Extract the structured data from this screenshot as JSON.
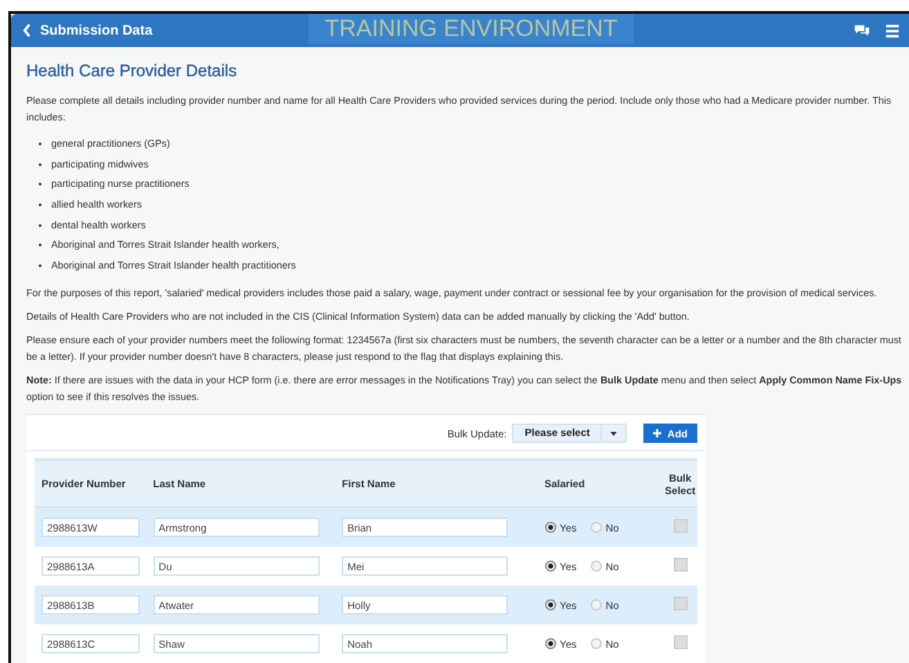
{
  "header": {
    "back_label": "Submission Data",
    "banner": "TRAINING ENVIRONMENT"
  },
  "heading": "Health Care Provider Details",
  "intro": "Please complete all details including provider number and name for all Health Care Providers who provided services during the period. Include only those who had a Medicare provider number. This includes:",
  "bullets": [
    "general practitioners (GPs)",
    "participating midwives",
    "participating nurse practitioners",
    "allied health workers",
    "dental health workers",
    "Aboriginal and Torres Strait Islander health workers,",
    "Aboriginal and Torres Strait Islander health practitioners"
  ],
  "paragraphs": [
    "For the purposes of this report, 'salaried' medical providers includes those paid a salary, wage, payment under contract or sessional fee by your organisation for the provision of medical services.",
    "Details of Health Care Providers who are not included in the CIS (Clinical Information System) data can be added manually by clicking the 'Add' button.",
    "Please ensure each of your provider numbers meet the following format: 1234567a (first six characters must be numbers, the seventh character can be a letter or a number and the 8th character must be a letter). If your provider number doesn't have 8 characters, please just respond to the flag that displays explaining this.",
    "**Note:** If there are issues with the data in your HCP form (i.e. there are error messages in the Notifications Tray) you can select the **Bulk Update** menu and then select **Apply Common Name Fix-Ups** option to see if this resolves the issues."
  ],
  "bulk_update": {
    "label": "Bulk Update:",
    "placeholder": "Please select"
  },
  "add_button": "Add",
  "table": {
    "columns": [
      "Provider Number",
      "Last Name",
      "First Name",
      "Salaried",
      "Bulk Select"
    ],
    "rows": [
      {
        "provider_number": "2988613W",
        "last_name": "Armstrong",
        "first_name": "Brian",
        "salaried": [
          {
            "label": "Yes",
            "selected": true
          },
          {
            "label": "No",
            "selected": false
          }
        ],
        "bulk_select": false
      },
      {
        "provider_number": "2988613A",
        "last_name": "Du",
        "first_name": "Mei",
        "salaried": [
          {
            "label": "Yes",
            "selected": true
          },
          {
            "label": "No",
            "selected": false
          }
        ],
        "bulk_select": false
      },
      {
        "provider_number": "2988613B",
        "last_name": "Atwater",
        "first_name": "Holly",
        "salaried": [
          {
            "label": "Yes",
            "selected": true
          },
          {
            "label": "No",
            "selected": false
          }
        ],
        "bulk_select": false
      },
      {
        "provider_number": "2988613C",
        "last_name": "Shaw",
        "first_name": "Noah",
        "salaried": [
          {
            "label": "Yes",
            "selected": true
          },
          {
            "label": "No",
            "selected": false
          }
        ],
        "bulk_select": false
      }
    ]
  }
}
